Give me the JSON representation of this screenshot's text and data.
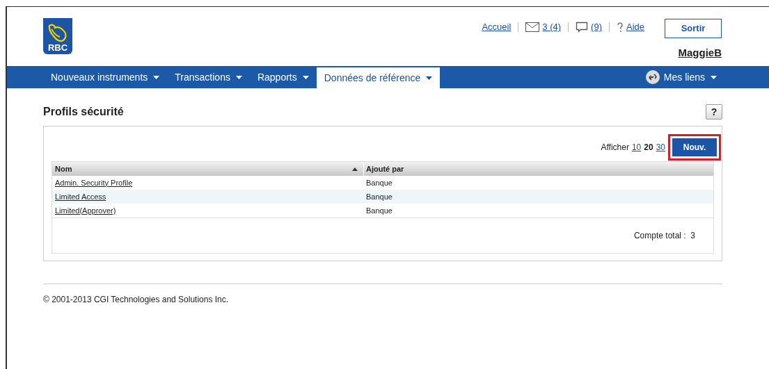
{
  "logo": {
    "text": "RBC"
  },
  "header_links": [
    {
      "kind": "link",
      "label": "Accueil"
    },
    {
      "kind": "mail",
      "label": "3 (4)"
    },
    {
      "kind": "chat",
      "label": "(9)"
    },
    {
      "kind": "help",
      "label": "Aide"
    }
  ],
  "logout_button": "Sortir",
  "user": "MaggieB",
  "nav": [
    {
      "label": "Nouveaux instruments",
      "selected": false
    },
    {
      "label": "Transactions",
      "selected": false
    },
    {
      "label": "Rapports",
      "selected": false
    },
    {
      "label": "Données de référence",
      "selected": true
    }
  ],
  "my_links": "Mes liens",
  "page_title": "Profils sécurité",
  "help_button": "?",
  "page_size": {
    "label": "Afficher",
    "options": [
      {
        "label": "10",
        "selected": false
      },
      {
        "label": "20",
        "selected": true
      },
      {
        "label": "30",
        "selected": false
      }
    ]
  },
  "new_button": {
    "label": "Nouv.",
    "highlighted": true
  },
  "table": {
    "columns": [
      {
        "label": "Nom",
        "sorted": true
      },
      {
        "label": "Ajouté par",
        "sorted": false
      }
    ],
    "rows": [
      [
        "Admin. Security Profile",
        "Banque"
      ],
      [
        "Limited Access",
        "Banque"
      ],
      [
        "Limited(Approver)",
        "Banque"
      ]
    ]
  },
  "total": "Compte total :  3",
  "footer": "© 2001-2013 CGI Technologies and Solutions Inc."
}
